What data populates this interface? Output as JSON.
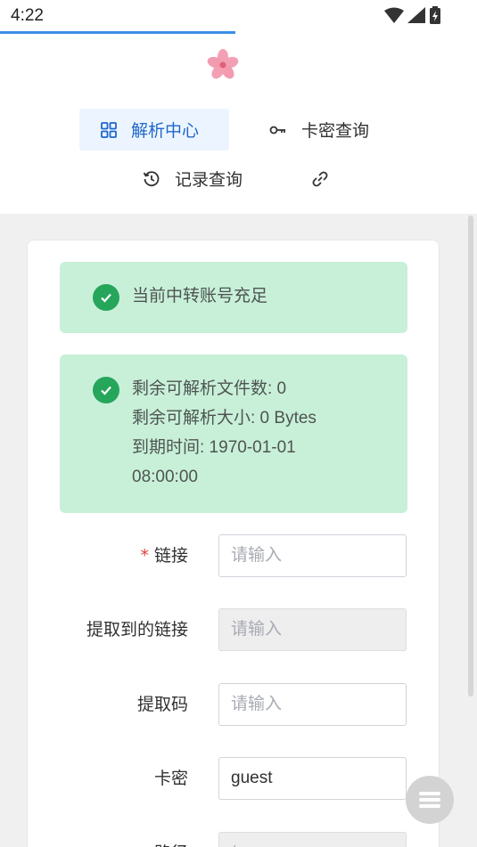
{
  "status_bar": {
    "time": "4:22"
  },
  "nav": {
    "items": [
      {
        "label": "解析中心",
        "icon": "grid-icon",
        "active": true
      },
      {
        "label": "卡密查询",
        "icon": "key-icon",
        "active": false
      },
      {
        "label": "记录查询",
        "icon": "history-icon",
        "active": false
      },
      {
        "label": "",
        "icon": "link-icon",
        "active": false
      }
    ]
  },
  "alerts": [
    {
      "lines": [
        "当前中转账号充足"
      ]
    },
    {
      "lines": [
        "剩余可解析文件数: 0",
        "剩余可解析大小: 0 Bytes",
        "到期时间: 1970-01-01",
        "08:00:00"
      ]
    }
  ],
  "form": {
    "fields": [
      {
        "label": "链接",
        "required": true,
        "value": "",
        "placeholder": "请输入",
        "disabled": false
      },
      {
        "label": "提取到的链接",
        "required": false,
        "value": "",
        "placeholder": "请输入",
        "disabled": true
      },
      {
        "label": "提取码",
        "required": false,
        "value": "",
        "placeholder": "请输入",
        "disabled": false
      },
      {
        "label": "卡密",
        "required": false,
        "value": "guest",
        "placeholder": "请输入",
        "disabled": false
      },
      {
        "label": "路径",
        "required": false,
        "value": "",
        "placeholder": "/",
        "disabled": true
      }
    ]
  },
  "colors": {
    "accent": "#1f67c9",
    "success_bg": "#c8f0d8",
    "success_icon": "#26a65b",
    "required": "#e04040"
  }
}
